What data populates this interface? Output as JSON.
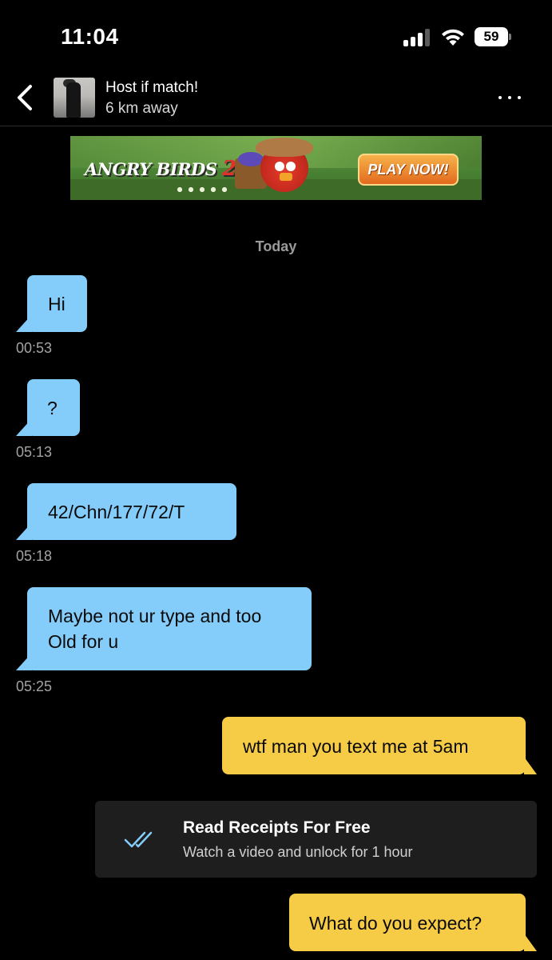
{
  "status_bar": {
    "time": "11:04",
    "battery": "59"
  },
  "header": {
    "name": "Host if match!",
    "distance": "6 km away"
  },
  "ad": {
    "logo": "ANGRY BIRDS",
    "logo_num": "2",
    "cta": "PLAY NOW!"
  },
  "date_divider": "Today",
  "messages": [
    {
      "direction": "in",
      "text": "Hi",
      "time": "00:53"
    },
    {
      "direction": "in",
      "text": "?",
      "time": "05:13"
    },
    {
      "direction": "in",
      "text": "42/Chn/177/72/T",
      "time": "05:18"
    },
    {
      "direction": "in",
      "lines": [
        "Maybe not ur type and too",
        "Old for u"
      ],
      "time": "05:25"
    },
    {
      "direction": "out",
      "text": "wtf man you text me at 5am"
    },
    {
      "direction": "out",
      "text": "What do you expect?"
    }
  ],
  "read_receipts": {
    "title": "Read Receipts For Free",
    "subtitle": "Watch a video and unlock for 1 hour"
  },
  "colors": {
    "incoming": "#84cdfa",
    "outgoing": "#f6cb45",
    "background": "#000000",
    "checkmark": "#84cdfa"
  }
}
